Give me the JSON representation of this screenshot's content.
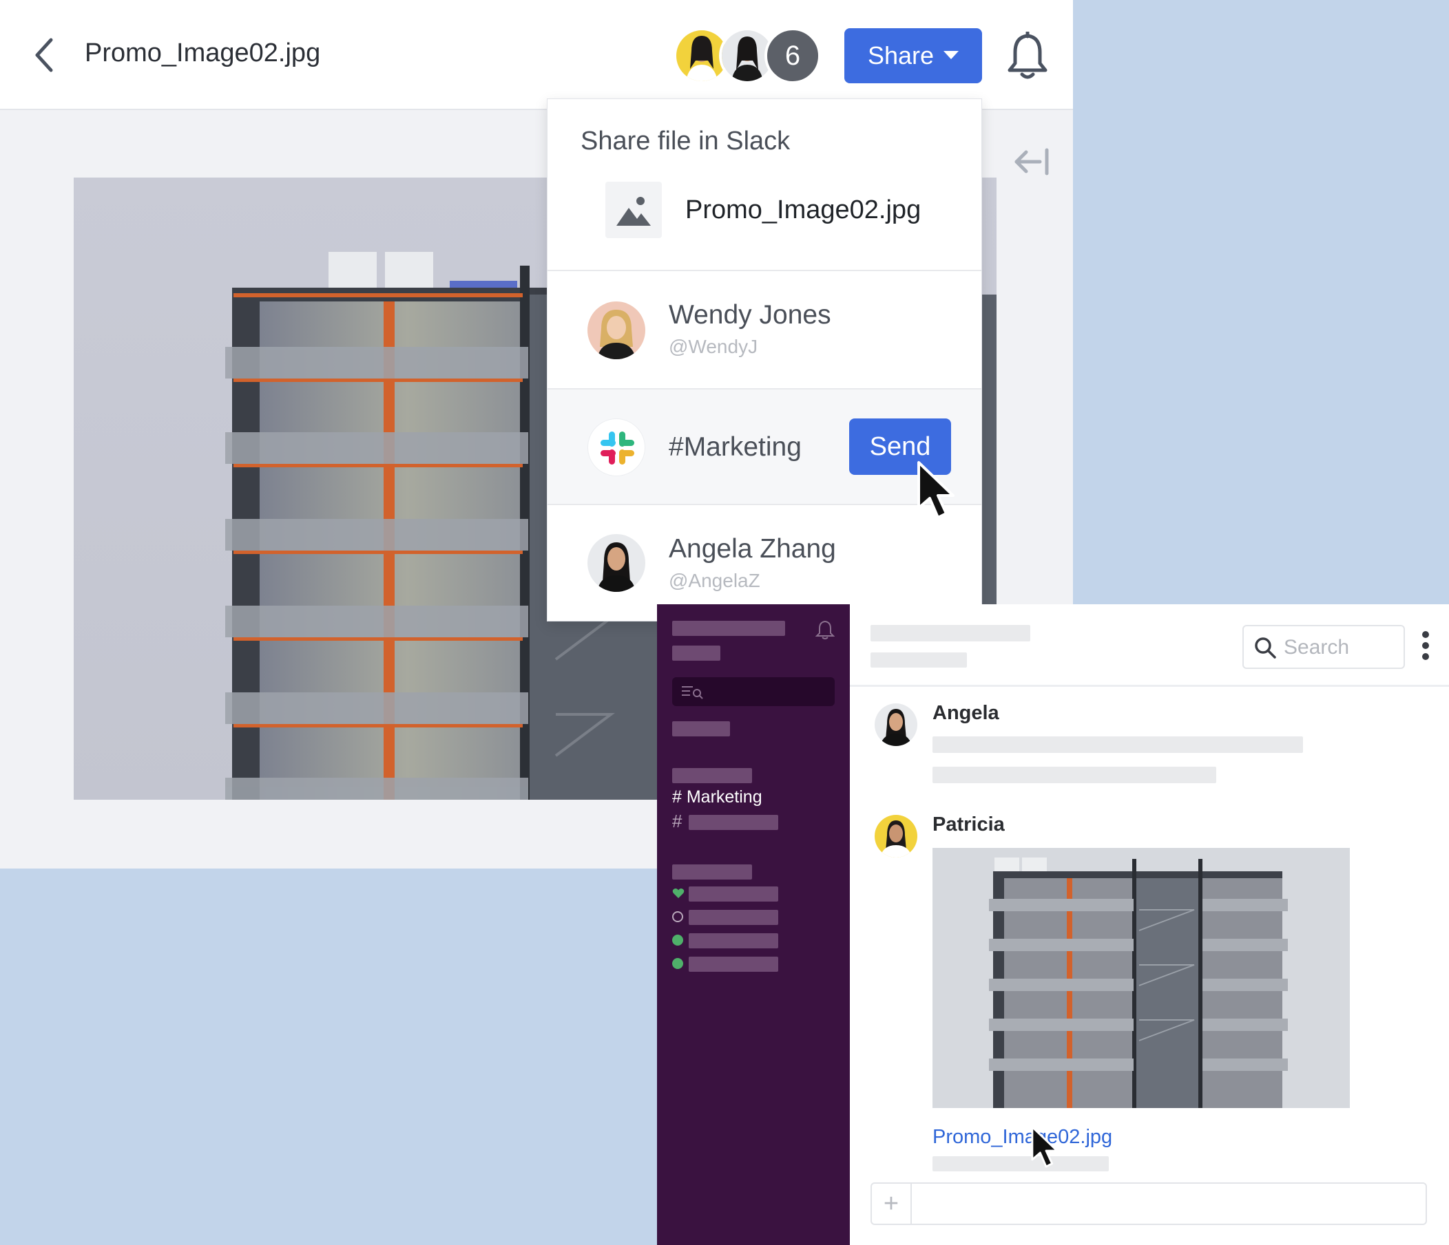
{
  "viewer": {
    "file_title": "Promo_Image02.jpg",
    "collaborators": {
      "extra_count": "6"
    },
    "share_button_label": "Share",
    "icons": [
      "back-arrow-icon",
      "bell-icon",
      "collapse-panel-icon",
      "chevron-down-icon"
    ]
  },
  "share_menu": {
    "title": "Share file in Slack",
    "file_name": "Promo_Image02.jpg",
    "recipients": [
      {
        "name": "Wendy Jones",
        "handle": "@WendyJ"
      },
      {
        "name": "#Marketing",
        "handle": ""
      },
      {
        "name": "Angela Zhang",
        "handle": "@AngelaZ"
      }
    ],
    "send_button_label": "Send"
  },
  "slack": {
    "sidebar": {
      "channel_label": "# Marketing",
      "hash_symbol": "#"
    },
    "search_placeholder": "Search",
    "messages": [
      {
        "author": "Angela"
      },
      {
        "author": "Patricia",
        "attachment_name": "Promo_Image02.jpg"
      }
    ],
    "composer_plus": "+"
  },
  "colors": {
    "background": "#c2d4ea",
    "accent_blue": "#3d6ce0",
    "slack_sidebar": "#3a1240",
    "link_blue": "#2f66d8",
    "presence_green": "#4fb06a"
  }
}
